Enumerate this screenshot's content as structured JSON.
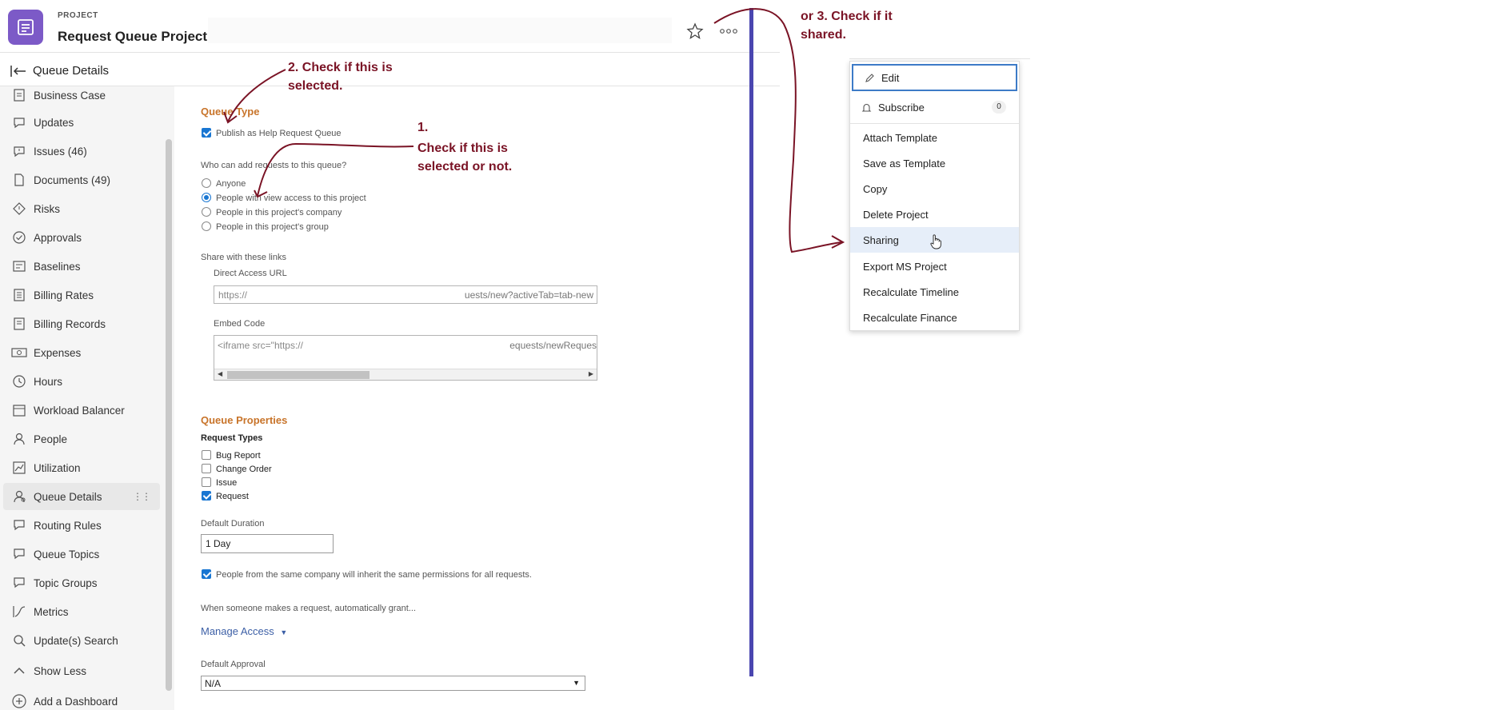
{
  "header": {
    "type_label": "PROJECT",
    "title": "Request Queue Project"
  },
  "subheader": {
    "title": "Queue Details"
  },
  "sidebar": {
    "items": [
      {
        "label": "Business Case",
        "icon": "business-case-icon"
      },
      {
        "label": "Updates",
        "icon": "updates-icon"
      },
      {
        "label": "Issues (46)",
        "icon": "issues-icon"
      },
      {
        "label": "Documents (49)",
        "icon": "documents-icon"
      },
      {
        "label": "Risks",
        "icon": "risks-icon"
      },
      {
        "label": "Approvals",
        "icon": "approvals-icon"
      },
      {
        "label": "Baselines",
        "icon": "baselines-icon"
      },
      {
        "label": "Billing Rates",
        "icon": "billing-rates-icon"
      },
      {
        "label": "Billing Records",
        "icon": "billing-records-icon"
      },
      {
        "label": "Expenses",
        "icon": "expenses-icon"
      },
      {
        "label": "Hours",
        "icon": "hours-icon"
      },
      {
        "label": "Workload Balancer",
        "icon": "workload-balancer-icon"
      },
      {
        "label": "People",
        "icon": "people-icon"
      },
      {
        "label": "Utilization",
        "icon": "utilization-icon"
      },
      {
        "label": "Queue Details",
        "icon": "queue-details-icon",
        "active": true
      },
      {
        "label": "Routing Rules",
        "icon": "routing-rules-icon"
      },
      {
        "label": "Queue Topics",
        "icon": "queue-topics-icon"
      },
      {
        "label": "Topic Groups",
        "icon": "topic-groups-icon"
      },
      {
        "label": "Metrics",
        "icon": "metrics-icon"
      },
      {
        "label": "Update(s) Search",
        "icon": "search-icon"
      },
      {
        "label": "Show Less",
        "icon": "chevron-up-icon"
      },
      {
        "label": "Add a Dashboard",
        "icon": "plus-circle-icon"
      }
    ]
  },
  "queue_type": {
    "title": "Queue Type",
    "publish_label": "Publish as Help Request Queue",
    "publish_checked": true,
    "who_label": "Who can add requests to this queue?",
    "options": [
      {
        "label": "Anyone",
        "selected": false
      },
      {
        "label": "People with view access to this project",
        "selected": true
      },
      {
        "label": "People in this project's company",
        "selected": false
      },
      {
        "label": "People in this project's group",
        "selected": false
      }
    ],
    "share_label": "Share with these links",
    "direct_url_label": "Direct Access URL",
    "direct_url_start": "https://",
    "direct_url_end": "uests/new?activeTab=tab-new",
    "embed_label": "Embed Code",
    "embed_start": "<iframe src=\"https://",
    "embed_end": "equests/newReques"
  },
  "queue_properties": {
    "title": "Queue Properties",
    "request_types_label": "Request Types",
    "request_types": [
      {
        "label": "Bug Report",
        "checked": false
      },
      {
        "label": "Change Order",
        "checked": false
      },
      {
        "label": "Issue",
        "checked": false
      },
      {
        "label": "Request",
        "checked": true
      }
    ],
    "default_duration_label": "Default Duration",
    "default_duration_value": "1 Day",
    "inherit_label": "People from the same company will inherit the same permissions for all requests.",
    "inherit_checked": true,
    "grant_label": "When someone makes a request, automatically grant...",
    "manage_access_label": "Manage Access",
    "default_approval_label": "Default Approval",
    "default_approval_value": "N/A"
  },
  "menu": {
    "items": [
      {
        "label": "Edit",
        "icon": "pencil-icon"
      },
      {
        "label": "Subscribe",
        "icon": "bell-icon",
        "badge": "0"
      },
      {
        "label": "Attach Template"
      },
      {
        "label": "Save as Template"
      },
      {
        "label": "Copy"
      },
      {
        "label": "Delete Project"
      },
      {
        "label": "Sharing"
      },
      {
        "label": "Export MS Project"
      },
      {
        "label": "Recalculate Timeline"
      },
      {
        "label": "Recalculate Finance"
      }
    ]
  },
  "annotations": {
    "note1_num": "1.",
    "note1_text_a": "Check if this is",
    "note1_text_b": "selected or not.",
    "note2_a": "2. Check if this is",
    "note2_b": "selected.",
    "note3_a": "or 3. Check if it",
    "note3_b": "shared.",
    "color": "#7a1325"
  },
  "colors": {
    "accent": "#c8742a",
    "link": "#3c5fa6",
    "brand": "#7c5ac7",
    "divider_bar": "#4a46b0",
    "checkbox": "#1976d2"
  }
}
